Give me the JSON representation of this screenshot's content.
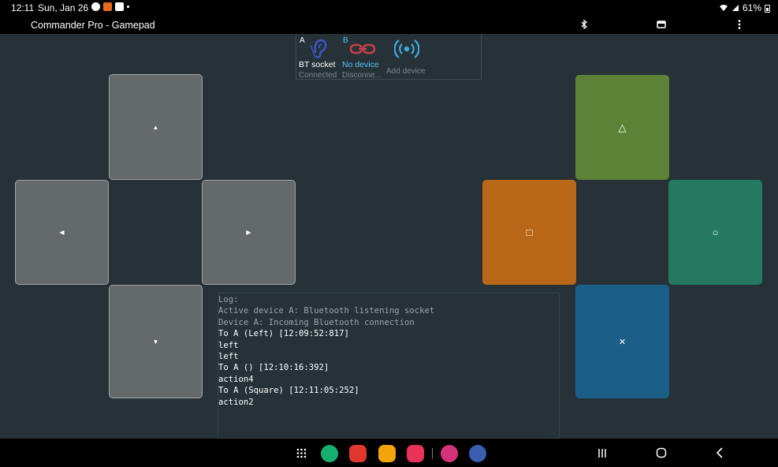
{
  "status_bar": {
    "time": "12:11",
    "date": "Sun, Jan 26",
    "battery": "61%",
    "notification_icons": [
      "messenger-icon",
      "app-notification-icon",
      "gallery-icon",
      "dot-icon"
    ]
  },
  "app_bar": {
    "title": "Commander Pro - Gamepad",
    "icons": [
      "bluetooth-icon",
      "window-icon",
      "more-vert-icon"
    ]
  },
  "devices": [
    {
      "slot": "A",
      "name": "BT socket",
      "status": "Connected",
      "icon": "ear-icon",
      "color": "#3d57c9"
    },
    {
      "slot": "B",
      "name": "No device",
      "status": "Disconne...",
      "icon": "broken-link-icon",
      "color": "#c94048",
      "name_color": "#4fc3f7"
    },
    {
      "slot": "",
      "name": "",
      "status": "Add device",
      "icon": "broadcast-icon",
      "color": "#3fa9e0"
    }
  ],
  "dpad": {
    "up": {
      "symbol": "▲",
      "icon": "arrow-up-icon"
    },
    "left": {
      "symbol": "◀",
      "icon": "arrow-left-icon"
    },
    "right": {
      "symbol": "▶",
      "icon": "arrow-right-icon"
    },
    "down": {
      "symbol": "▼",
      "icon": "arrow-down-icon"
    },
    "color": "#64696b"
  },
  "face_buttons": {
    "triangle": {
      "symbol": "△",
      "color": "#5c8236"
    },
    "square": {
      "symbol": "□",
      "color": "#b86816"
    },
    "circle": {
      "symbol": "○",
      "color": "#237a61"
    },
    "cross": {
      "symbol": "✕",
      "color": "#1b5e86"
    }
  },
  "log": {
    "header": "Log:",
    "lines": [
      {
        "text": "Active device A: Bluetooth listening socket",
        "dim": true
      },
      {
        "text": "Device A: Incoming Bluetooth connection",
        "dim": true
      },
      {
        "text": "To A (Left) [12:09:52:817]",
        "dim": false
      },
      {
        "text": "left",
        "dim": false
      },
      {
        "text": "left",
        "dim": false
      },
      {
        "text": "To A () [12:10:16:392]",
        "dim": false
      },
      {
        "text": "action4",
        "dim": false
      },
      {
        "text": "To A (Square) [12:11:05:252]",
        "dim": false
      },
      {
        "text": "action2",
        "dim": false
      }
    ]
  },
  "nav_bar": {
    "apps": [
      {
        "icon": "apps-grid-icon",
        "color": "#000000"
      },
      {
        "icon": "phone-app-icon",
        "color": "#16b06e"
      },
      {
        "icon": "flipboard-app-icon",
        "color": "#e0382f"
      },
      {
        "icon": "files-app-icon",
        "color": "#f2a50a"
      },
      {
        "icon": "camera-app-icon",
        "color": "#e8325a"
      },
      {
        "icon": "blossom-app-icon",
        "color": "#d6327a"
      },
      {
        "icon": "settings-app-icon",
        "color": "#3a5fb0"
      }
    ],
    "buttons": [
      "recents-icon",
      "home-icon",
      "back-icon"
    ]
  }
}
